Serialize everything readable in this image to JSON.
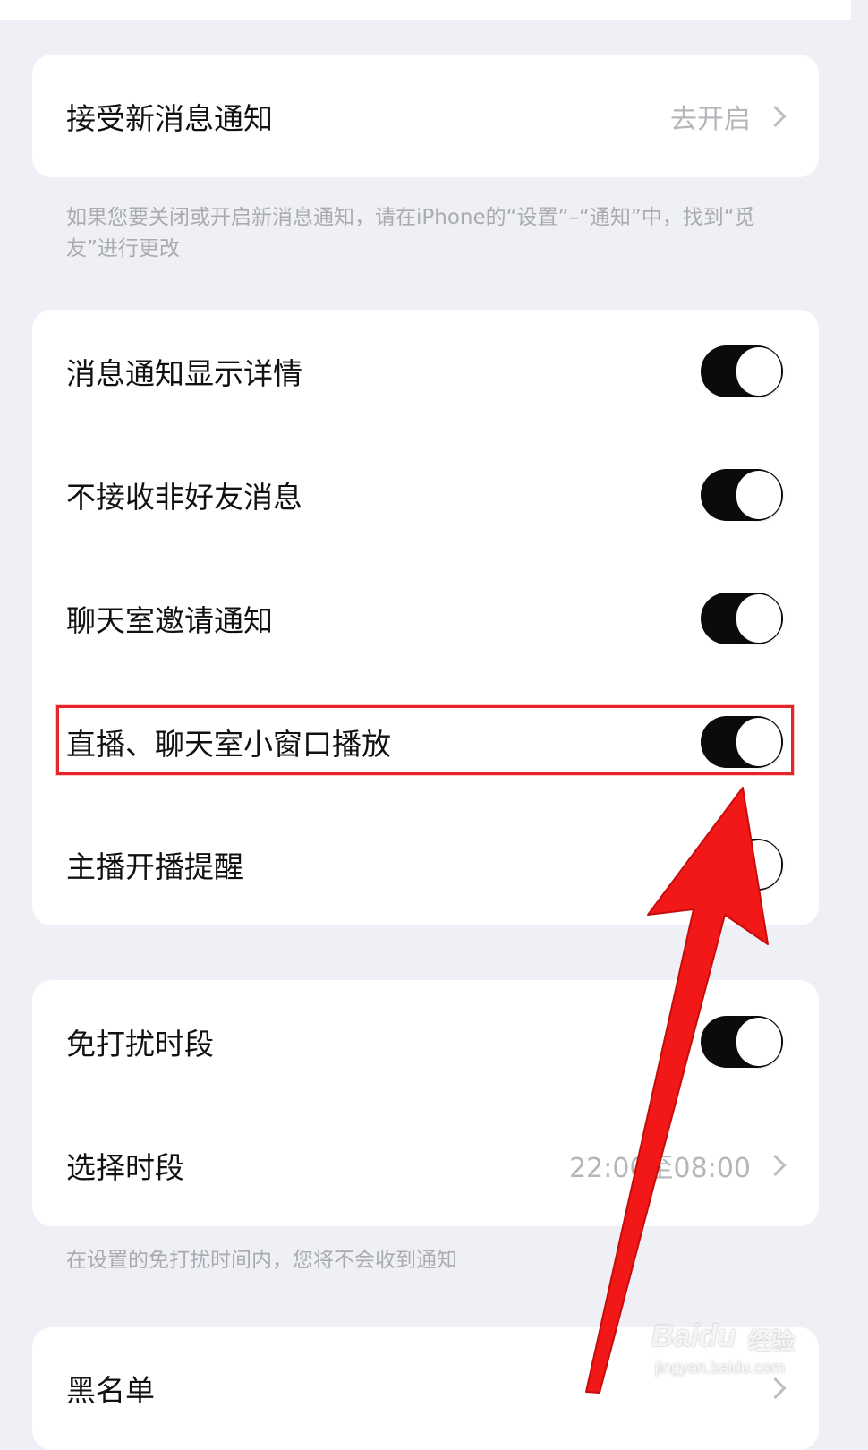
{
  "notify_card": {
    "label": "接受新消息通知",
    "value": "去开启"
  },
  "notify_note": "如果您要关闭或开启新消息通知，请在iPhone的“设置”–“通知”中，找到“觅友”进行更改",
  "toggles": [
    {
      "label": "消息通知显示详情",
      "on": true
    },
    {
      "label": "不接收非好友消息",
      "on": true
    },
    {
      "label": "聊天室邀请通知",
      "on": true
    },
    {
      "label": "直播、聊天室小窗口播放",
      "on": true
    },
    {
      "label": "主播开播提醒",
      "on": true
    }
  ],
  "dnd": {
    "label": "免打扰时段",
    "on": true,
    "select_label": "选择时段",
    "select_value": "22:00至08:00"
  },
  "dnd_note": "在设置的免打扰时间内，您将不会收到通知",
  "blacklist": {
    "label": "黑名单"
  },
  "annotation": {
    "color": "#e8242b"
  },
  "watermark": {
    "logo": "Baidu",
    "cn": "经验",
    "url": "jingyan.baidu.com"
  },
  "colors": {
    "background": "#eef0f6",
    "toggle_on": "#0b0b0b",
    "secondary_text": "#b5b6ba"
  }
}
